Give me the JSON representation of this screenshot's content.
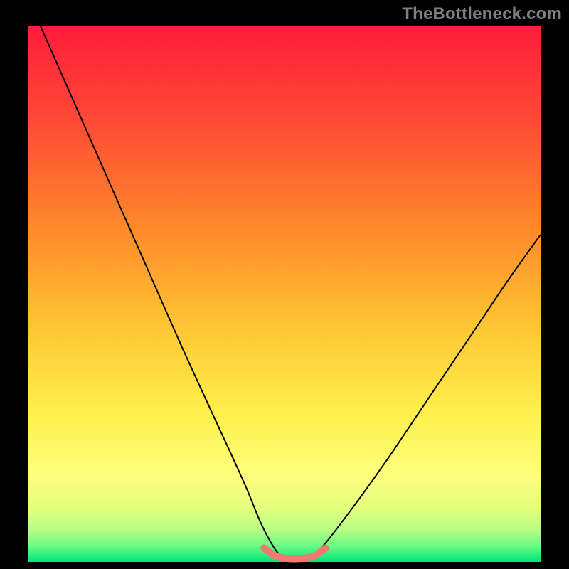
{
  "watermark_text": "TheBottleneck.com",
  "chart_data": {
    "type": "line",
    "title": "",
    "xlabel": "",
    "ylabel": "",
    "xlim": [
      0,
      100
    ],
    "ylim": [
      0,
      100
    ],
    "note": "Plot area shows a vertical gradient background from red (top) through orange/yellow to green (bottom), with a black V-shaped curve and a short salmon-colored segment near the bottom. Axes and ticks are not labeled.",
    "background_gradient": [
      {
        "pos": 0,
        "color": "#ff1b3c"
      },
      {
        "pos": 18,
        "color": "#ff4a35"
      },
      {
        "pos": 38,
        "color": "#ff8a2a"
      },
      {
        "pos": 55,
        "color": "#ffc233"
      },
      {
        "pos": 72,
        "color": "#fff04a"
      },
      {
        "pos": 84,
        "color": "#fdff7c"
      },
      {
        "pos": 90,
        "color": "#e4ff7e"
      },
      {
        "pos": 94,
        "color": "#b6ff84"
      },
      {
        "pos": 97,
        "color": "#6dfb86"
      },
      {
        "pos": 100,
        "color": "#00e57a"
      }
    ],
    "series": [
      {
        "name": "bottleneck-curve",
        "color": "#000000",
        "width": 2,
        "x": [
          0,
          6,
          12,
          18,
          24,
          30,
          36,
          42,
          46,
          49.5,
          52,
          55,
          58,
          64,
          70,
          76,
          82,
          88,
          94,
          100
        ],
        "values": [
          105,
          92,
          79,
          66,
          53,
          40,
          27.5,
          15,
          6,
          0.8,
          0.6,
          0.8,
          3.5,
          11,
          19,
          27.5,
          36,
          44.5,
          53,
          61
        ]
      },
      {
        "name": "optimal-zone",
        "color": "#ed7b74",
        "width": 10,
        "linecap": "round",
        "x": [
          46,
          48,
          50,
          52,
          54,
          56,
          58
        ],
        "values": [
          2.6,
          1.2,
          0.7,
          0.6,
          0.7,
          1.2,
          2.6
        ]
      }
    ]
  }
}
